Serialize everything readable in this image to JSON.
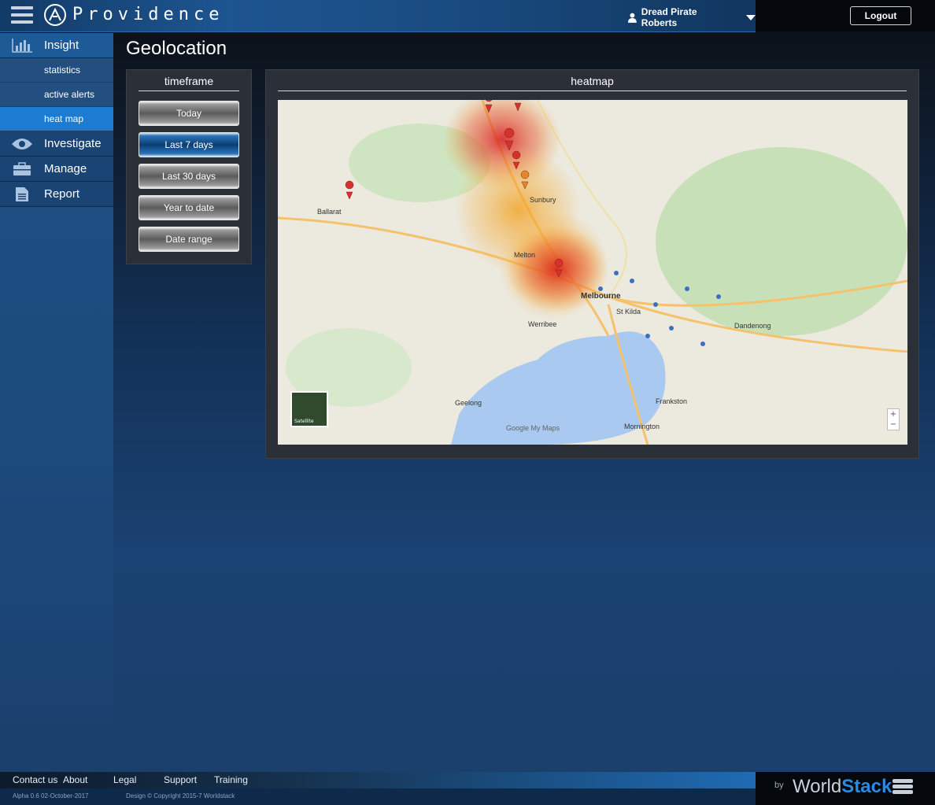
{
  "header": {
    "logo_text": "Providence",
    "user_name": "Dread Pirate Roberts",
    "logout_label": "Logout"
  },
  "sidebar": {
    "items": [
      {
        "label": "Insight",
        "icon": "bar-chart-icon",
        "active": true,
        "sub": [
          {
            "label": "statistics"
          },
          {
            "label": "active alerts"
          },
          {
            "label": "heat map",
            "active": true
          }
        ]
      },
      {
        "label": "Investigate",
        "icon": "eye-icon"
      },
      {
        "label": "Manage",
        "icon": "briefcase-icon"
      },
      {
        "label": "Report",
        "icon": "document-icon"
      }
    ]
  },
  "page": {
    "title": "Geolocation"
  },
  "timeframe": {
    "title": "timeframe",
    "buttons": [
      "Today",
      "Last 7 days",
      "Last 30 days",
      "Year to date",
      "Date range"
    ],
    "selected": "Last 7 days"
  },
  "heatmap": {
    "title": "heatmap",
    "city_labels": [
      "Melbourne",
      "Geelong",
      "Frankston",
      "Werribee",
      "Ballarat",
      "Sunbury",
      "Melton",
      "St Kilda",
      "Dandenong",
      "Mornington"
    ],
    "satellite_label": "Satellite",
    "zoom_in": "+",
    "zoom_out": "−",
    "attribution": "Google My Maps"
  },
  "footer": {
    "links": [
      "Contact us",
      "About",
      "Legal",
      "Support",
      "Training"
    ],
    "version": "Alpha 0.6 02-October-2017",
    "copyright": "Design © Copyright 2015-7 Worldstack",
    "by": "by",
    "brand_a": "World",
    "brand_b": "Stack"
  },
  "colors": {
    "accent": "#1d7bd1",
    "heat_hot": "#d7191c",
    "heat_warm": "#f39c12"
  }
}
